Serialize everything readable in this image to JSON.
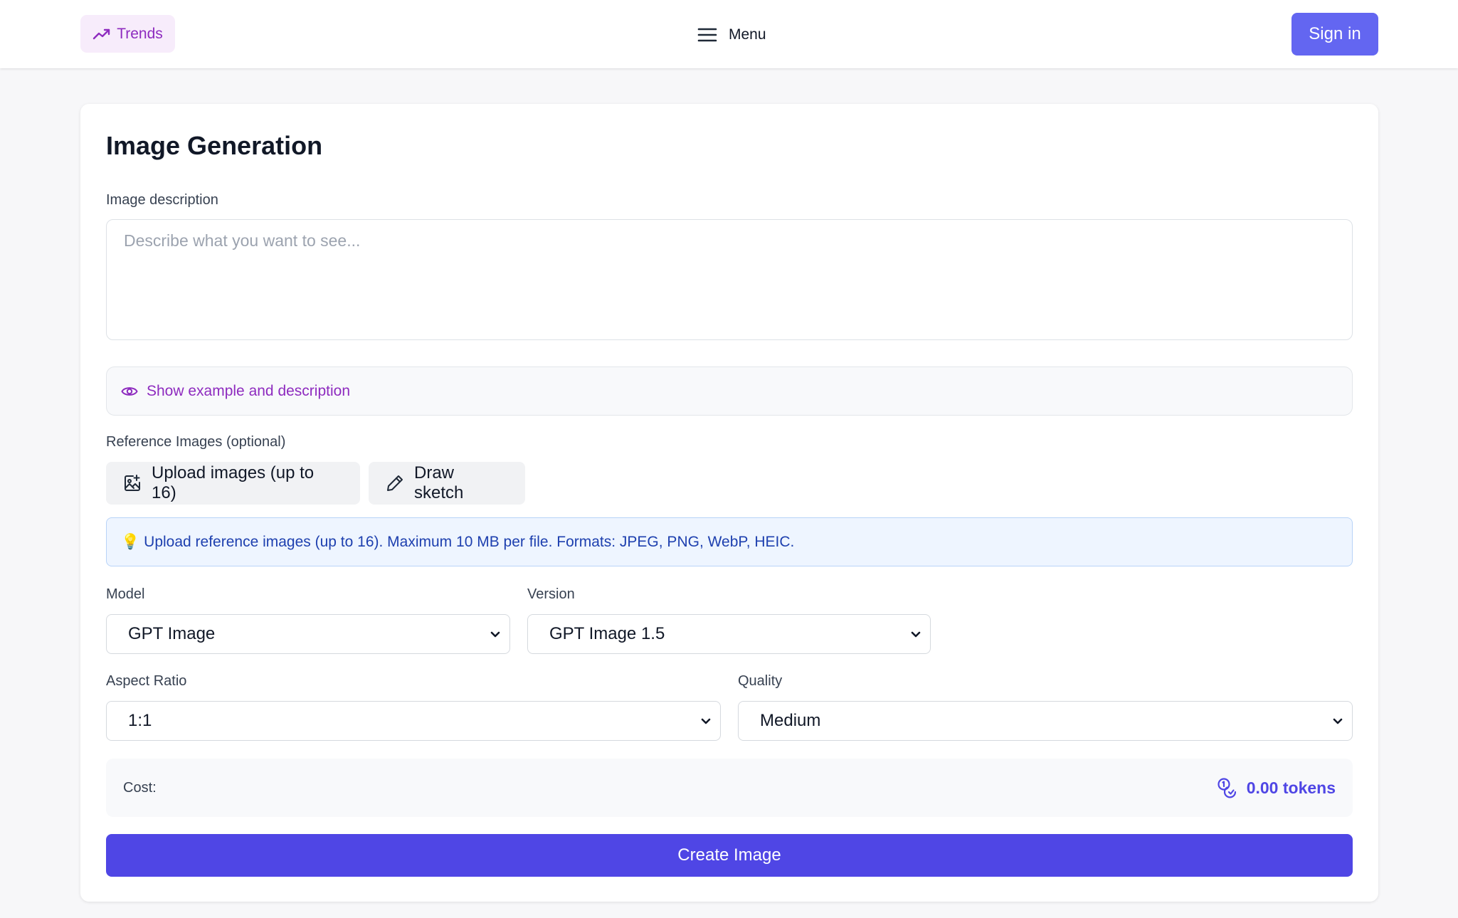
{
  "header": {
    "trends_label": "Trends",
    "menu_label": "Menu",
    "signin_label": "Sign in"
  },
  "form": {
    "title": "Image Generation",
    "description_label": "Image description",
    "description_placeholder": "Describe what you want to see...",
    "description_value": "",
    "example_toggle_label": "Show example and description",
    "reference_label": "Reference Images (optional)",
    "upload_button_label": "Upload images (up to 16)",
    "sketch_button_label": "Draw sketch",
    "info_icon": "💡",
    "info_text": "Upload reference images (up to 16). Maximum 10 MB per file. Formats: JPEG, PNG, WebP, HEIC.",
    "model_label": "Model",
    "model_value": "GPT Image",
    "version_label": "Version",
    "version_value": "GPT Image 1.5",
    "aspect_label": "Aspect Ratio",
    "aspect_value": "1:1",
    "quality_label": "Quality",
    "quality_value": "Medium",
    "cost_label": "Cost:",
    "cost_value": "0.00 tokens",
    "create_button_label": "Create Image"
  },
  "colors": {
    "accent_purple": "#8e2bbf",
    "primary_indigo": "#4f46e5",
    "signin_indigo": "#6366f1",
    "info_blue": "#1e40af"
  },
  "icons": {
    "trends": "trending-up-icon",
    "menu": "hamburger-menu-icon",
    "example": "eye-icon",
    "upload": "image-plus-icon",
    "sketch": "pencil-icon",
    "select": "chevron-down-icon",
    "cost": "coins-icon"
  }
}
